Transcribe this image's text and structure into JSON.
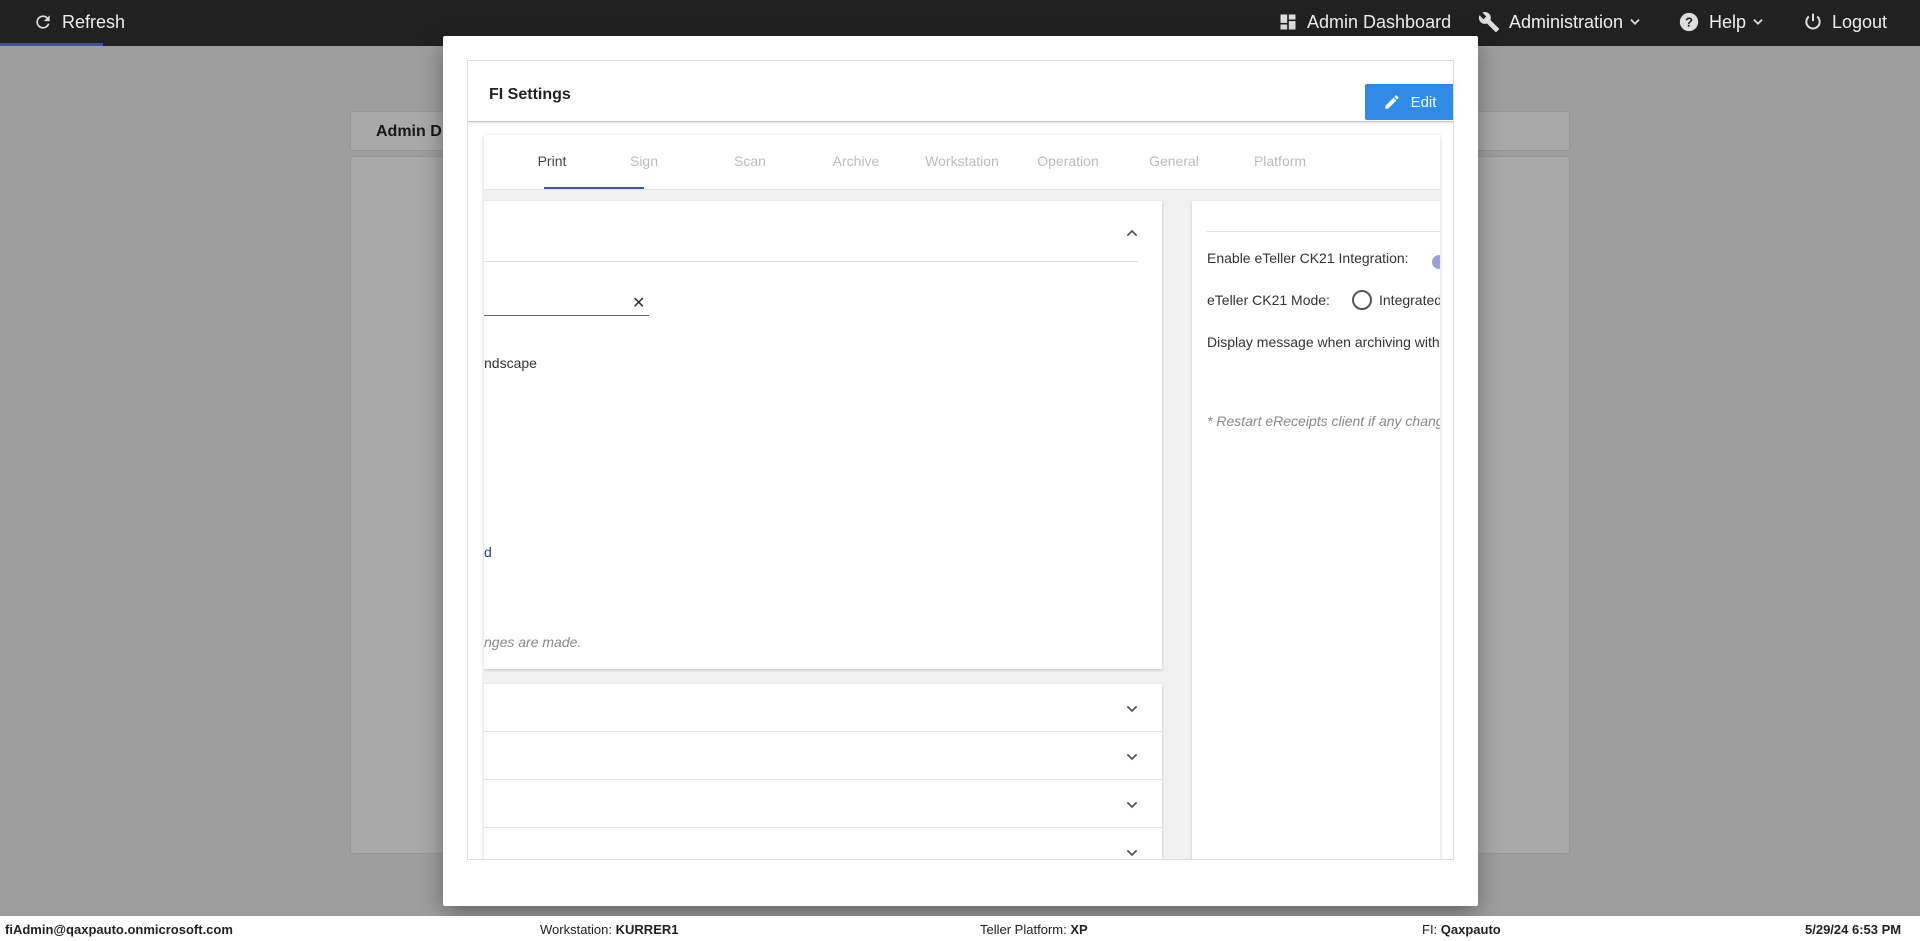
{
  "topnav": {
    "refresh_label": "Refresh",
    "admin_dashboard_label": "Admin Dashboard",
    "administration_label": "Administration",
    "help_label": "Help",
    "logout_label": "Logout"
  },
  "background": {
    "header_title": "Admin D"
  },
  "modal": {
    "title": "FI Settings",
    "edit_label": "Edit",
    "tabs": [
      "Print",
      "Sign",
      "Scan",
      "Archive",
      "Workstation",
      "Operation",
      "General",
      "Platform"
    ],
    "active_tab": "Print",
    "left_card": {
      "landscape_text": "ndscape",
      "link_text": "d",
      "note_text": "nges are made."
    },
    "right_card": {
      "enable_ck21_label": "Enable eTeller CK21 Integration:",
      "ck21_mode_label": "eTeller CK21 Mode:",
      "ck21_mode_option": "Integrated",
      "display_message_label": "Display message when archiving with",
      "restart_note": "* Restart eReceipts client if any chang"
    }
  },
  "footer": {
    "user": "fiAdmin@qaxpauto.onmicrosoft.com",
    "workstation_label": "Workstation:",
    "workstation_value": "KURRER1",
    "platform_label": "Teller Platform:",
    "platform_value": "XP",
    "fi_label": "FI:",
    "fi_value": "Qaxpauto",
    "datetime": "5/29/24 6:53 PM"
  },
  "colors": {
    "nav_bg": "#212121",
    "accent": "#3f51b5",
    "edit_button": "#2f8be6"
  }
}
